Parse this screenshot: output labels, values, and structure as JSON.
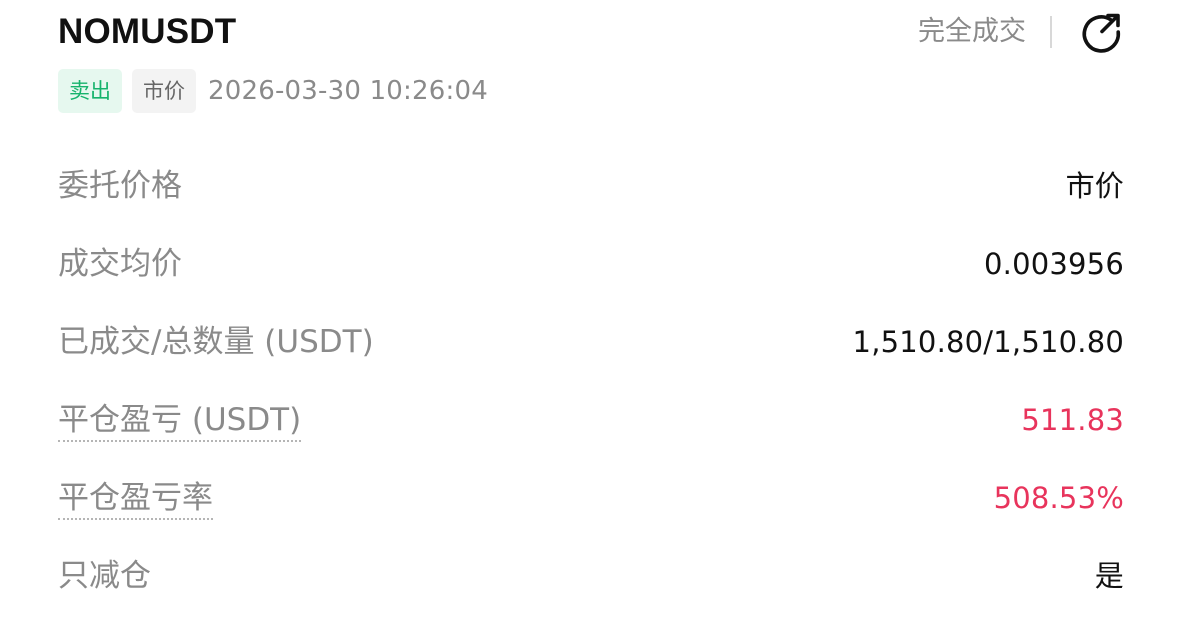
{
  "order": {
    "symbol": "NOMUSDT",
    "status": "完全成交",
    "side_tag": "卖出",
    "type_tag": "市价",
    "time": "2026-03-30 10:26:04"
  },
  "icons": {
    "share": "share-arrow-icon"
  },
  "colors": {
    "side_green": "#16b36c",
    "pnl_red": "#e8345c",
    "muted": "#8a8a8a"
  },
  "details": [
    {
      "label": "委托价格",
      "value": "市价"
    },
    {
      "label": "成交均价",
      "value": "0.003956"
    },
    {
      "label": "已成交/总数量 (USDT)",
      "value": "1,510.80/1,510.80"
    },
    {
      "label": "平仓盈亏 (USDT)",
      "value": "511.83"
    },
    {
      "label": "平仓盈亏率",
      "value": "508.53%"
    },
    {
      "label": "只减仓",
      "value": "是"
    }
  ]
}
